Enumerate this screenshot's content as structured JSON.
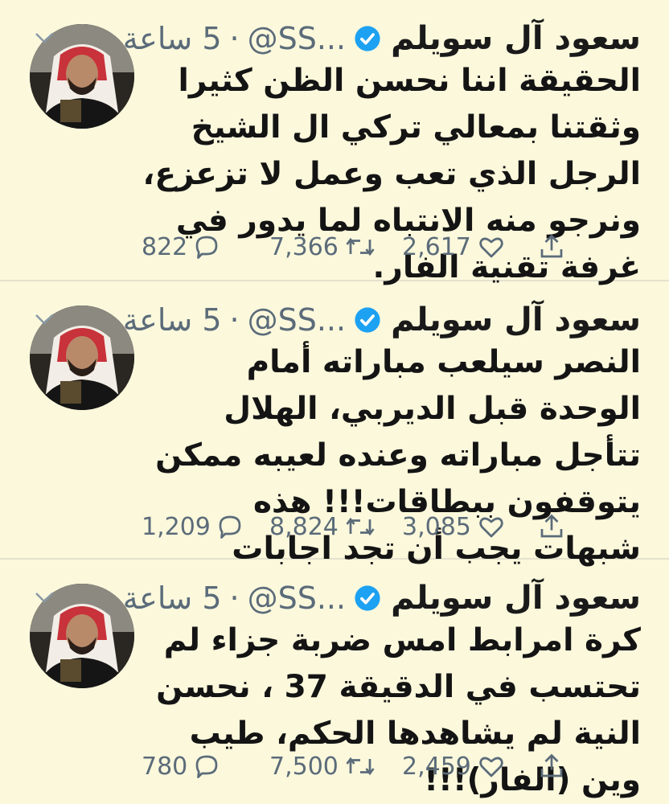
{
  "tweets": [
    {
      "name": "سعود آل سويلم",
      "handle": "@SS...",
      "separator": "·",
      "time": "5 ساعة",
      "text": "الحقيقة اننا نحسن الظن كثيرا وثقتنا بمعالي تركي ال الشيخ الرجل الذي تعب وعمل لا تزعزع، ونرجو منه الانتباه لما يدور في غرفة تقنية الفار.",
      "replies": "822",
      "retweets": "7,366",
      "likes": "2,617"
    },
    {
      "name": "سعود آل سويلم",
      "handle": "@SS...",
      "separator": "·",
      "time": "5 ساعة",
      "text": "النصر سيلعب مباراته أمام الوحدة قبل الديربي، الهلال تتأجل مباراته وعنده لعيبه ممكن يتوقفون ببطاقات!!! هذه شبهات يجب أن تجد اجابات",
      "replies": "1,209",
      "retweets": "8,824",
      "likes": "3,085"
    },
    {
      "name": "سعود آل سويلم",
      "handle": "@SS...",
      "separator": "·",
      "time": "5 ساعة",
      "text": "كرة امرابط امس ضربة جزاء لم تحتسب في الدقيقة 37 ، نحسن النية لم يشاهدها الحكم، طيب وين (الفار)!!!",
      "replies": "780",
      "retweets": "7,500",
      "likes": "2,459"
    }
  ],
  "icons": {
    "reply": "reply-icon",
    "retweet": "retweet-icon",
    "like": "heart-icon",
    "share": "share-icon",
    "verified": "verified-badge-icon",
    "more": "chevron-down-icon"
  },
  "colors": {
    "background": "#fbf8dc",
    "muted": "#5b6b79",
    "verified": "#1da1f2",
    "text": "#141414"
  }
}
